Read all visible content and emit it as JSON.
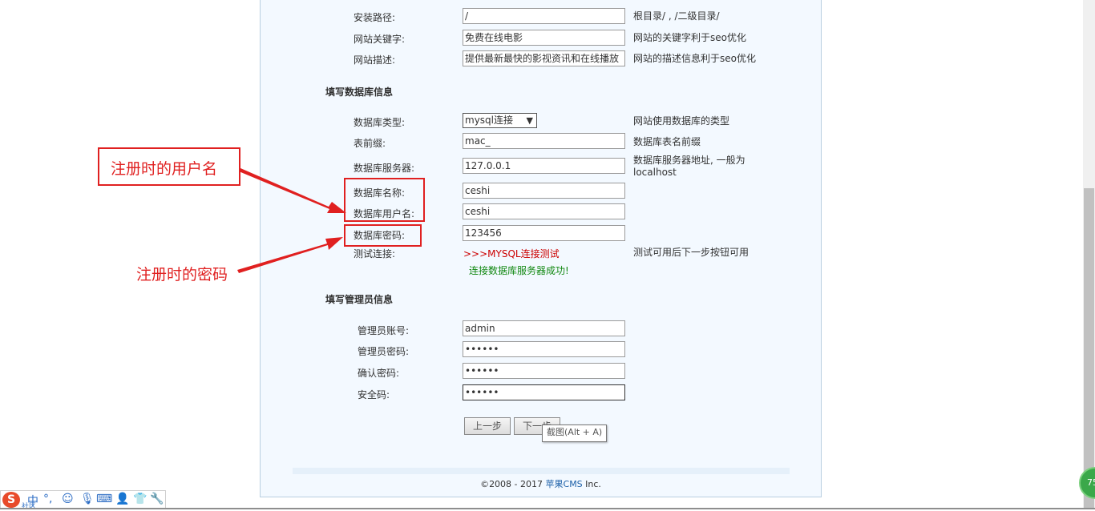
{
  "site": {
    "path_label": "安装路径:",
    "path_value": "/",
    "path_hint": "根目录/ , /二级目录/",
    "keywords_label": "网站关键字:",
    "keywords_value": "免费在线电影",
    "keywords_hint": "网站的关键字利于seo优化",
    "desc_label": "网站描述:",
    "desc_value": "提供最新最快的影视资讯和在线播放",
    "desc_hint": "网站的描述信息利于seo优化"
  },
  "db": {
    "section_title": "填写数据库信息",
    "type_label": "数据库类型:",
    "type_value": "mysql连接",
    "type_hint": "网站使用数据库的类型",
    "prefix_label": "表前缀:",
    "prefix_value": "mac_",
    "prefix_hint": "数据库表名前缀",
    "server_label": "数据库服务器:",
    "server_value": "127.0.0.1",
    "server_hint_1": "数据库服务器地址, 一般为",
    "server_hint_2": "localhost",
    "name_label": "数据库名称:",
    "name_value": "ceshi",
    "user_label": "数据库用户名:",
    "user_value": "ceshi",
    "pass_label": "数据库密码:",
    "pass_value": "123456",
    "test_label": "测试连接:",
    "test_link": ">>>MYSQL连接测试",
    "test_hint": "测试可用后下一步按钮可用",
    "test_result": "连接数据库服务器成功!"
  },
  "admin": {
    "section_title": "填写管理员信息",
    "account_label": "管理员账号:",
    "account_value": "admin",
    "password_label": "管理员密码:",
    "password_value": "••••••",
    "confirm_label": "确认密码:",
    "confirm_value": "••••••",
    "safecode_label": "安全码:",
    "safecode_value": "••••••"
  },
  "buttons": {
    "prev": "上一步",
    "next": "下一步"
  },
  "tooltip": "截图(Alt + A)",
  "footer": {
    "copyright": "©2008 - 2017 ",
    "brand": "苹果CMS",
    "suffix": " Inc."
  },
  "annotations": {
    "username_note": "注册时的用户名",
    "password_note": "注册时的密码"
  },
  "ime": {
    "logo": "S",
    "mode": "中",
    "punct": "°,",
    "sub": "社区"
  },
  "badge": "75",
  "colors": {
    "annotation_red": "#e02020",
    "link_red": "#cc0000",
    "success_green": "#118811"
  }
}
